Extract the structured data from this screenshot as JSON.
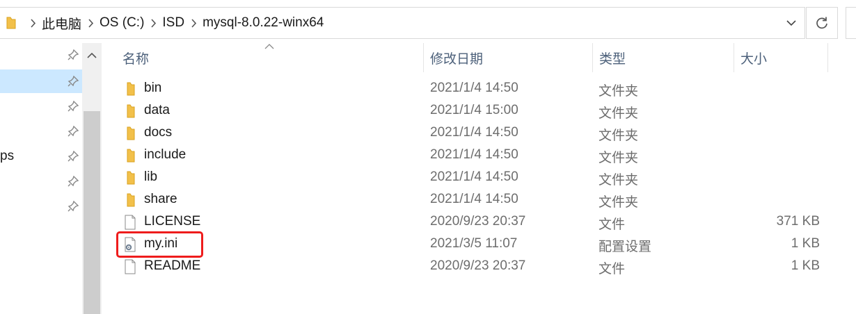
{
  "address_bar": {
    "segments": [
      "此电脑",
      "OS (C:)",
      "ISD",
      "mysql-8.0.22-winx64"
    ]
  },
  "nav": {
    "items": [
      {
        "label": "",
        "selected": false
      },
      {
        "label": "",
        "selected": true
      },
      {
        "label": "",
        "selected": false
      },
      {
        "label": "",
        "selected": false
      },
      {
        "label": "ps",
        "selected": false
      },
      {
        "label": "",
        "selected": false
      },
      {
        "label": "",
        "selected": false
      }
    ]
  },
  "columns": {
    "name": "名称",
    "date": "修改日期",
    "type": "类型",
    "size": "大小"
  },
  "files": [
    {
      "name": "bin",
      "date": "2021/1/4 14:50",
      "type": "文件夹",
      "size": "",
      "icon": "folder-icon"
    },
    {
      "name": "data",
      "date": "2021/1/4 15:00",
      "type": "文件夹",
      "size": "",
      "icon": "folder-icon"
    },
    {
      "name": "docs",
      "date": "2021/1/4 14:50",
      "type": "文件夹",
      "size": "",
      "icon": "folder-icon"
    },
    {
      "name": "include",
      "date": "2021/1/4 14:50",
      "type": "文件夹",
      "size": "",
      "icon": "folder-icon"
    },
    {
      "name": "lib",
      "date": "2021/1/4 14:50",
      "type": "文件夹",
      "size": "",
      "icon": "folder-icon"
    },
    {
      "name": "share",
      "date": "2021/1/4 14:50",
      "type": "文件夹",
      "size": "",
      "icon": "folder-icon"
    },
    {
      "name": "LICENSE",
      "date": "2020/9/23 20:37",
      "type": "文件",
      "size": "371 KB",
      "icon": "file-icon"
    },
    {
      "name": "my.ini",
      "date": "2021/3/5 11:07",
      "type": "配置设置",
      "size": "1 KB",
      "icon": "settings-file-icon"
    },
    {
      "name": "README",
      "date": "2020/9/23 20:37",
      "type": "文件",
      "size": "1 KB",
      "icon": "file-icon"
    }
  ],
  "colors": {
    "selection": "#cce8ff",
    "highlight_box": "#ee1c1c",
    "header_text": "#4c607a",
    "folder": "#f2c04a"
  }
}
